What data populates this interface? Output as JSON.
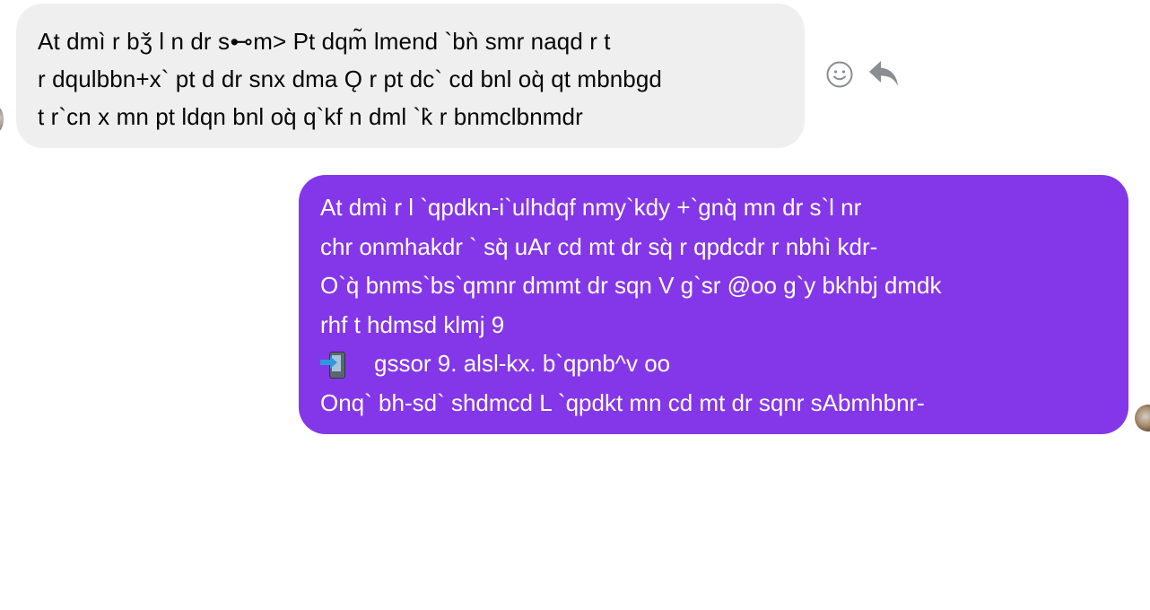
{
  "incoming_message": {
    "lines": [
      "At dmì r bǯ l  n dr s⊷m> Pt dqm̃ lmend  `bǹ smr naqd r t",
      "r dqulbbn+x`  pt d dr snx dma Ǫ r pt dc`  cd bnl  oq̀ qt mbnbgd",
      "t r`cn x mn pt ldqn bnl  oq̀ q`kf n dml  `k̀ r bnmclbnmdr"
    ]
  },
  "outgoing_message": {
    "lines": [
      "At dmì r l  `qpdkn-i`ulhdqf nmy`kdy +`gnq̀  mn dr s`l  nr",
      "chr onmhakdr  `  sq̀ uAr cd mt dr sq̀ r qpdcdr r nbhì kdr-",
      "O`q̀  bnms`bs`qmnr  dmmt dr sqn V g`sr @oo g`y bkhbj  dmdk",
      "rhf t hdmsd klmj 9"
    ],
    "link": "gssor 9. alsl-kx. b`qpnb^v oo",
    "closing": "Onq` bh-sd` shdmcd L `qpdkt mn cd mt dr sqnr sAbmhbnr-"
  },
  "icons": {
    "react": "smiley-icon",
    "reply": "reply-arrow-icon",
    "link_emoji": "mobile-phone-with-arrow-icon"
  },
  "colors": {
    "incoming_bubble": "#efefef",
    "outgoing_bubble": "#8437e9",
    "action_icon": "#8a8d91"
  }
}
